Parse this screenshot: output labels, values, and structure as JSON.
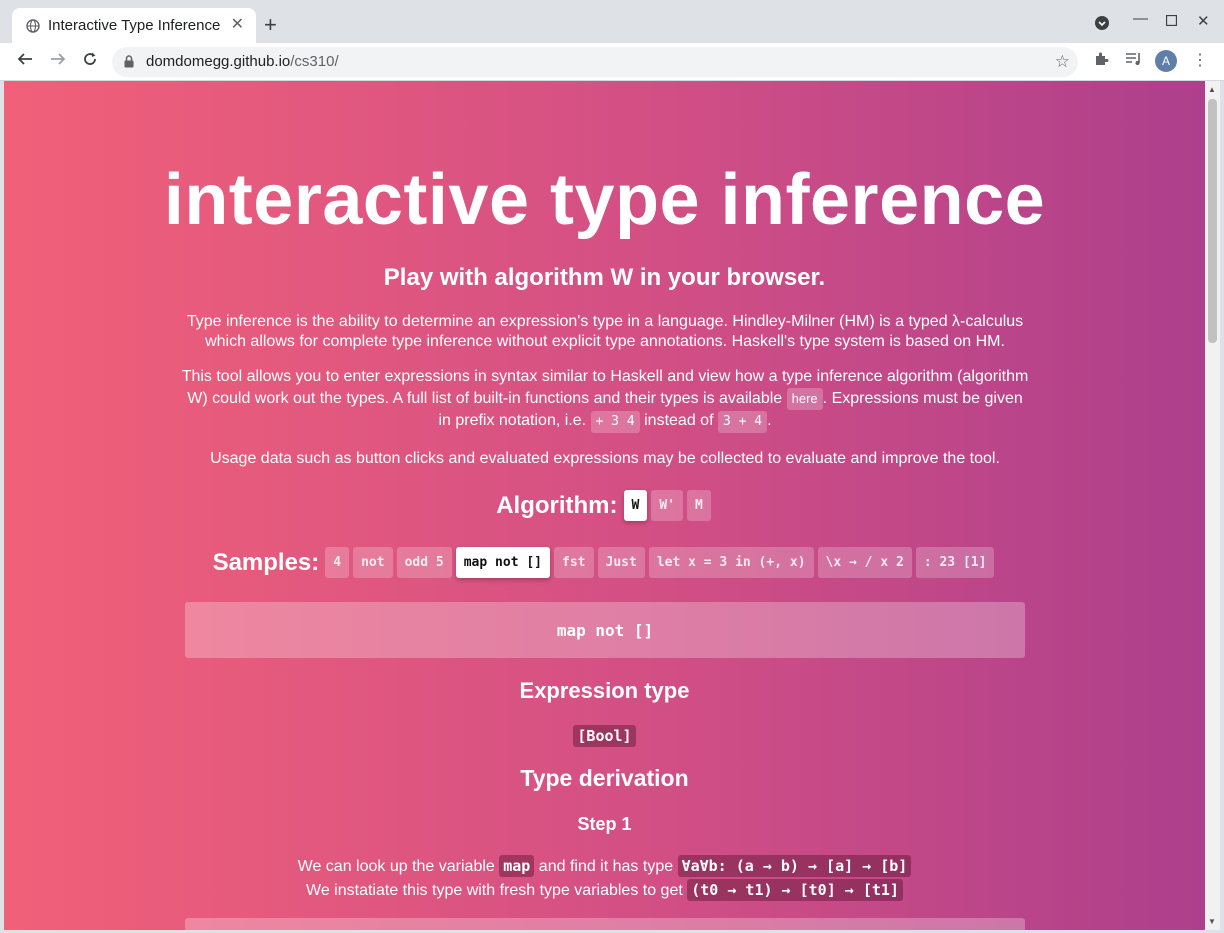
{
  "browser": {
    "tab_title": "Interactive Type Inference",
    "url_host": "domdomegg.github.io",
    "url_path": "/cs310/",
    "avatar_letter": "A"
  },
  "page": {
    "title": "interactive type inference",
    "subtitle": "Play with algorithm W in your browser.",
    "intro": "Type inference is the ability to determine an expression's type in a language. Hindley-Milner (HM) is a typed λ-calculus which allows for complete type inference without explicit type annotations. Haskell's type system is based on HM.",
    "tool_p1": "This tool allows you to enter expressions in syntax similar to Haskell and view how a type inference algorithm (algorithm W) could work out the types. A full list of built-in functions and their types is available",
    "here_link": "here",
    "tool_p2": ". Expressions must be given in prefix notation, i.e.",
    "prefix_example": "+ 3 4",
    "instead_of": "instead of",
    "infix_example": "3 + 4",
    "period": ".",
    "usage": "Usage data such as button clicks and evaluated expressions may be collected to evaluate and improve the tool.",
    "algorithm_label": "Algorithm:",
    "algorithms": [
      "W",
      "W'",
      "M"
    ],
    "samples_label": "Samples:",
    "samples": [
      "4",
      "not",
      "odd 5",
      "map not []",
      "fst",
      "Just",
      "let x = 3 in (+, x)",
      "\\x → / x 2",
      ": 23 [1]"
    ],
    "expression": "map not []",
    "expression_type_heading": "Expression type",
    "expression_type": "[Bool]",
    "derivation_heading": "Type derivation",
    "step_title": "Step 1",
    "step_line1_a": "We can look up the variable",
    "step_var": "map",
    "step_line1_b": "and find it has type",
    "step_type": "∀a∀b: (a → b) → [a] → [b]",
    "step_line2_a": "We instatiate this type with fresh type variables to get",
    "step_inst": "(t0 → t1) → [t0] → [t1]"
  }
}
